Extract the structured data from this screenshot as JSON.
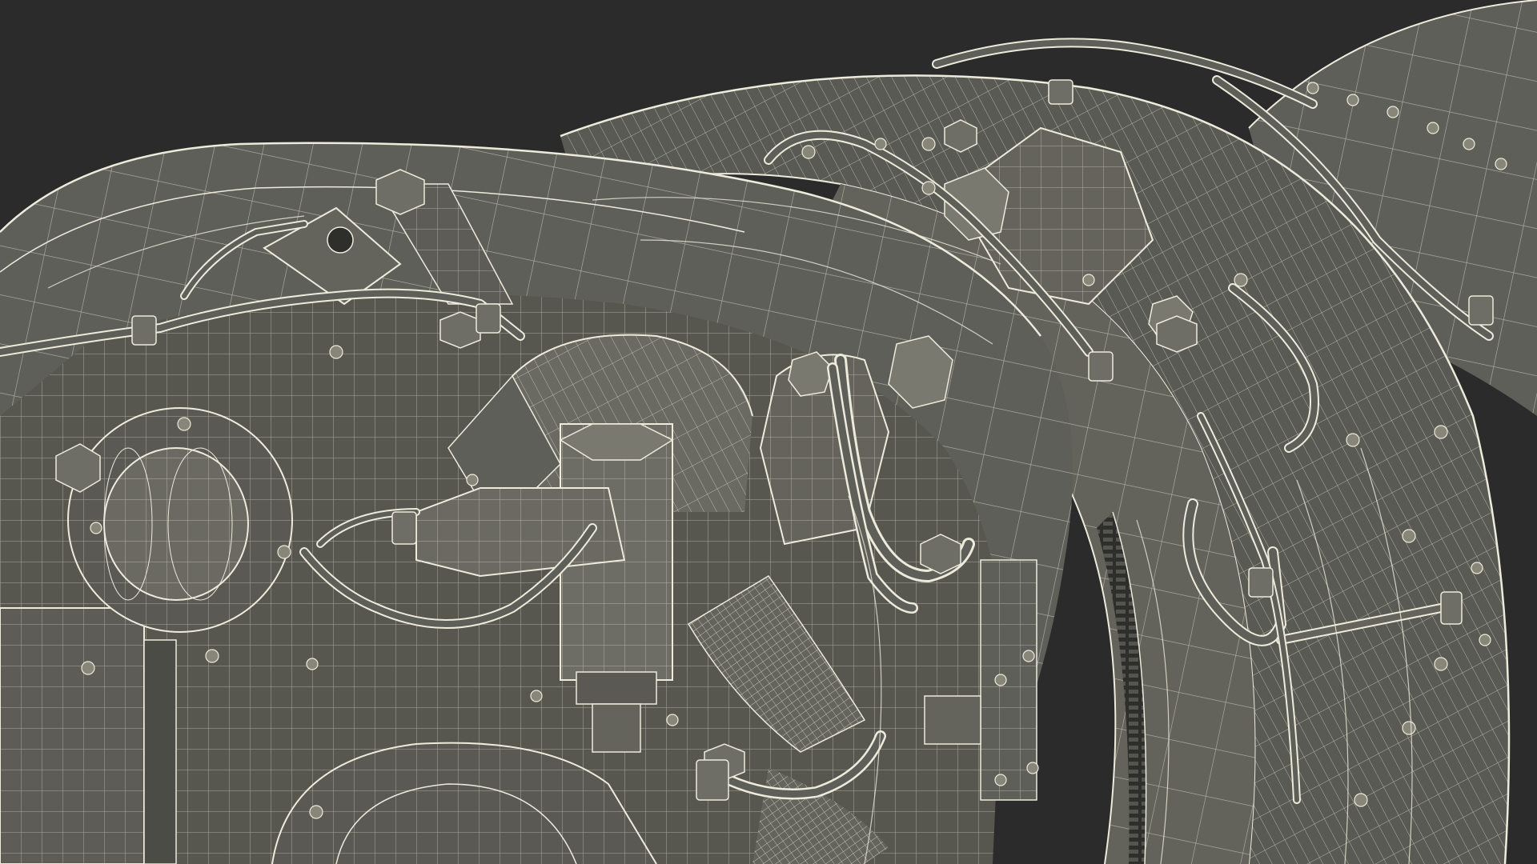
{
  "image": {
    "subject": "3d-wireframe-engine-render",
    "background_color": "#2b2b2b",
    "surface_color": "#5f5f59",
    "surface_dark_color": "#4c4c47",
    "surface_light_color": "#727169",
    "wire_color": "#ecebdc",
    "bolt_color": "#878678"
  }
}
